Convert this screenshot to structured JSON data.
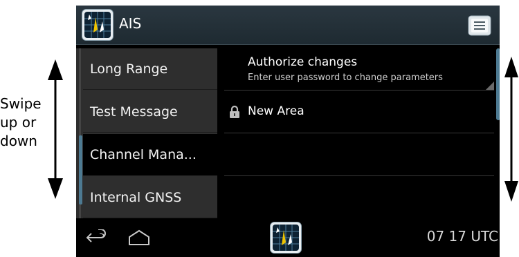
{
  "annotation": {
    "line1": "Swipe",
    "line2": "up or",
    "line3": "down"
  },
  "app": {
    "title": "AIS"
  },
  "sidebar": {
    "items": [
      {
        "label": "Long Range",
        "selected": false
      },
      {
        "label": "Test Message",
        "selected": false
      },
      {
        "label": "Channel Mana...",
        "selected": true
      },
      {
        "label": "Internal GNSS",
        "selected": false
      }
    ]
  },
  "main": {
    "authorize": {
      "title": "Authorize changes",
      "subtitle": "Enter user password to change parameters"
    },
    "new_area": {
      "label": "New Area",
      "icon": "lock-icon"
    }
  },
  "status": {
    "time": "07 17 UTC"
  },
  "colors": {
    "titlebar": "#233038",
    "sidebar": "#2e2e2e",
    "accent": "#4d7a92",
    "background": "#000000"
  }
}
